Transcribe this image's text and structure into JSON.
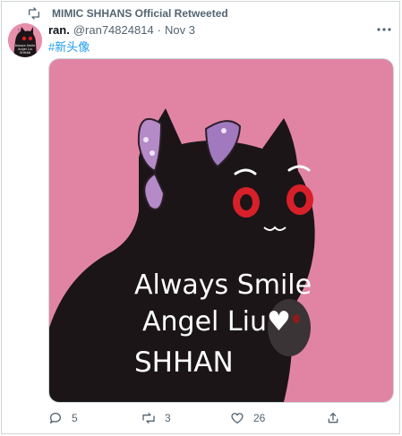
{
  "retweet_context": {
    "label": "MIMIC SHHANS Official Retweeted"
  },
  "tweet": {
    "author_name": "ran.",
    "author_handle": "@ran74824814",
    "separator": "·",
    "timestamp": "Nov 3",
    "hashtag": "#新头像",
    "image": {
      "overlay_lines": [
        "Always Smile",
        "Angel Liu♥",
        "SHHAN"
      ],
      "background_color": "#e184a4",
      "subject": "black cat with red eyes and purple butterfly"
    },
    "avatar": {
      "lines": [
        "Always Smile",
        "Angel Liu",
        "SHHAN"
      ]
    }
  },
  "actions": {
    "reply_count": "5",
    "retweet_count": "3",
    "like_count": "26"
  },
  "colors": {
    "accent": "#1d9bf0",
    "muted_text": "#536471",
    "text": "#0f1419"
  },
  "icons": {
    "retweet_header": "retweet-icon",
    "more": "more-icon",
    "reply": "reply-icon",
    "retweet": "retweet-icon",
    "like": "heart-icon",
    "share": "share-icon"
  }
}
